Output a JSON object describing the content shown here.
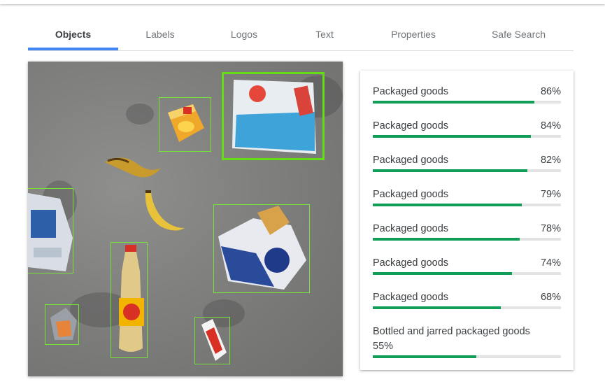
{
  "tabs": [
    {
      "label": "Objects",
      "active": true
    },
    {
      "label": "Labels",
      "active": false
    },
    {
      "label": "Logos",
      "active": false
    },
    {
      "label": "Text",
      "active": false
    },
    {
      "label": "Properties",
      "active": false
    },
    {
      "label": "Safe Search",
      "active": false
    }
  ],
  "colors": {
    "accent": "#4285f4",
    "bar_fill": "#0f9d58",
    "bar_track": "#e3e3e3",
    "box_stroke": "#76e23a"
  },
  "objects": [
    {
      "label": "Packaged goods",
      "score": "86%",
      "value": 0.86
    },
    {
      "label": "Packaged goods",
      "score": "84%",
      "value": 0.84
    },
    {
      "label": "Packaged goods",
      "score": "82%",
      "value": 0.82
    },
    {
      "label": "Packaged goods",
      "score": "79%",
      "value": 0.79
    },
    {
      "label": "Packaged goods",
      "score": "78%",
      "value": 0.78
    },
    {
      "label": "Packaged goods",
      "score": "74%",
      "value": 0.74
    },
    {
      "label": "Packaged goods",
      "score": "68%",
      "value": 0.68
    },
    {
      "label": "Bottled and jarred packaged goods",
      "score": "55%",
      "value": 0.55
    }
  ]
}
